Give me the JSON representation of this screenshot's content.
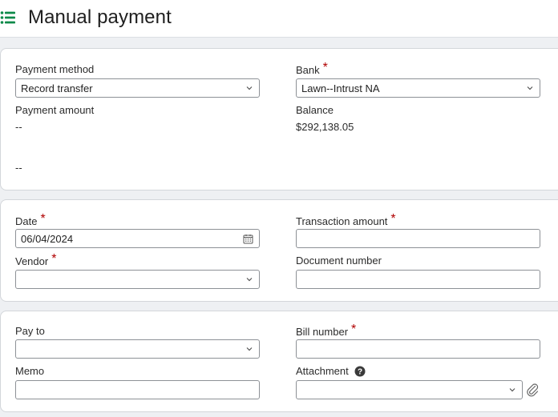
{
  "header": {
    "title": "Manual payment",
    "menu_icon": "list-icon"
  },
  "section1": {
    "payment_method": {
      "label": "Payment method",
      "value": "Record transfer"
    },
    "bank": {
      "label": "Bank",
      "required": "*",
      "value": "Lawn--Intrust NA"
    },
    "payment_amount": {
      "label": "Payment amount",
      "value": "--"
    },
    "balance": {
      "label": "Balance",
      "value": "$292,138.05"
    },
    "extra_value": "--"
  },
  "section2": {
    "date": {
      "label": "Date",
      "required": "*",
      "value": "06/04/2024"
    },
    "transaction_amount": {
      "label": "Transaction amount",
      "required": "*",
      "value": ""
    },
    "vendor": {
      "label": "Vendor",
      "required": "*",
      "value": ""
    },
    "document_number": {
      "label": "Document number",
      "value": ""
    }
  },
  "section3": {
    "pay_to": {
      "label": "Pay to",
      "value": ""
    },
    "bill_number": {
      "label": "Bill number",
      "required": "*",
      "value": ""
    },
    "memo": {
      "label": "Memo",
      "value": ""
    },
    "attachment": {
      "label": "Attachment",
      "value": ""
    }
  },
  "colors": {
    "accent": "#0d8a4a",
    "required": "#b00000",
    "border": "#8d9196"
  }
}
